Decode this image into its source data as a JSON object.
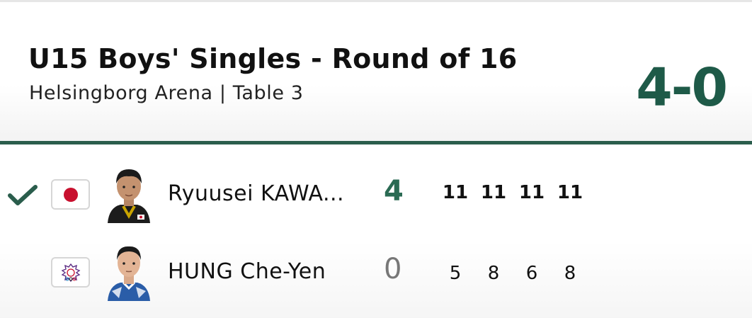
{
  "match": {
    "title": "U15 Boys' Singles - Round of 16",
    "venue": "Helsingborg Arena | Table 3",
    "score": "4-0"
  },
  "colors": {
    "accent": "#1e5a48",
    "divider": "#2a5d4c",
    "japan_red": "#c8102e",
    "tpe_purple": "#5a2a82"
  },
  "players": [
    {
      "name": "Ryuusei KAWA...",
      "flag_icon": "japan-flag-icon",
      "winner": true,
      "games_won": "4",
      "sets": [
        "11",
        "11",
        "11",
        "11"
      ]
    },
    {
      "name": "HUNG Che-Yen",
      "flag_icon": "chinese-taipei-flag-icon",
      "winner": false,
      "games_won": "0",
      "sets": [
        "5",
        "8",
        "6",
        "8"
      ]
    }
  ]
}
